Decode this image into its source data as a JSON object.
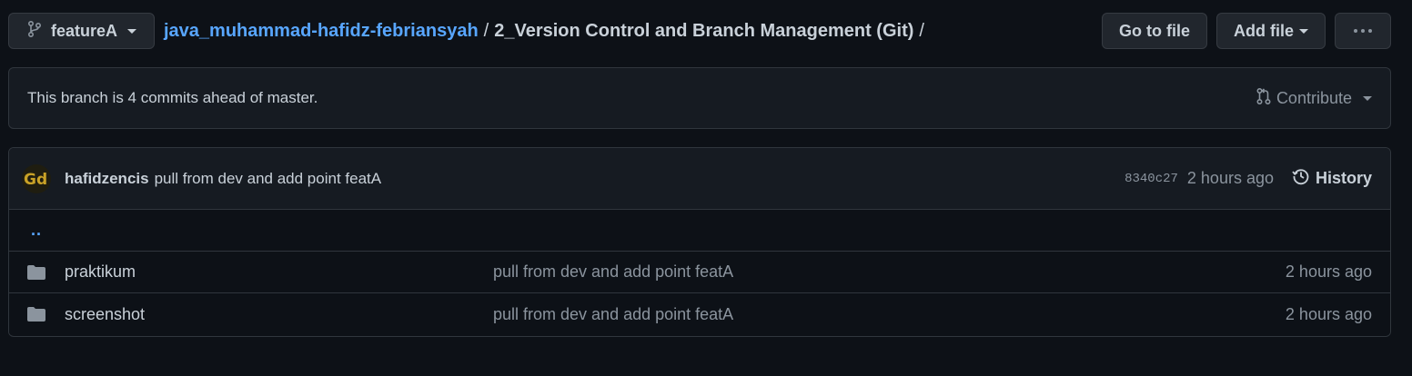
{
  "branch": {
    "name": "featureA",
    "icon": "git-branch-icon"
  },
  "breadcrumb": {
    "repo": "java_muhammad-hafidz-febriansyah",
    "separator": "/",
    "dir": "2_Version Control and Branch Management (Git)",
    "trailing": "/"
  },
  "actions": {
    "go_to_file": "Go to file",
    "add_file": "Add file",
    "more_icon": "kebab-horizontal-icon"
  },
  "branch_status": {
    "text": "This branch is 4 commits ahead of master.",
    "contribute": "Contribute",
    "contribute_icon": "git-pull-request-icon"
  },
  "latest_commit": {
    "author": "hafidzencis",
    "message": "pull from dev and add point featA",
    "sha": "8340c27",
    "time": "2 hours ago",
    "history": "History",
    "history_icon": "history-icon"
  },
  "parent_link": "..",
  "files": [
    {
      "name": "praktikum",
      "type": "folder",
      "message": "pull from dev and add point featA",
      "time": "2 hours ago"
    },
    {
      "name": "screenshot",
      "type": "folder",
      "message": "pull from dev and add point featA",
      "time": "2 hours ago"
    }
  ],
  "colors": {
    "background": "#0d1117",
    "panel": "#161b22",
    "border": "#30363d",
    "link": "#58a6ff",
    "muted": "#8b949e",
    "text": "#c9d1d9"
  }
}
